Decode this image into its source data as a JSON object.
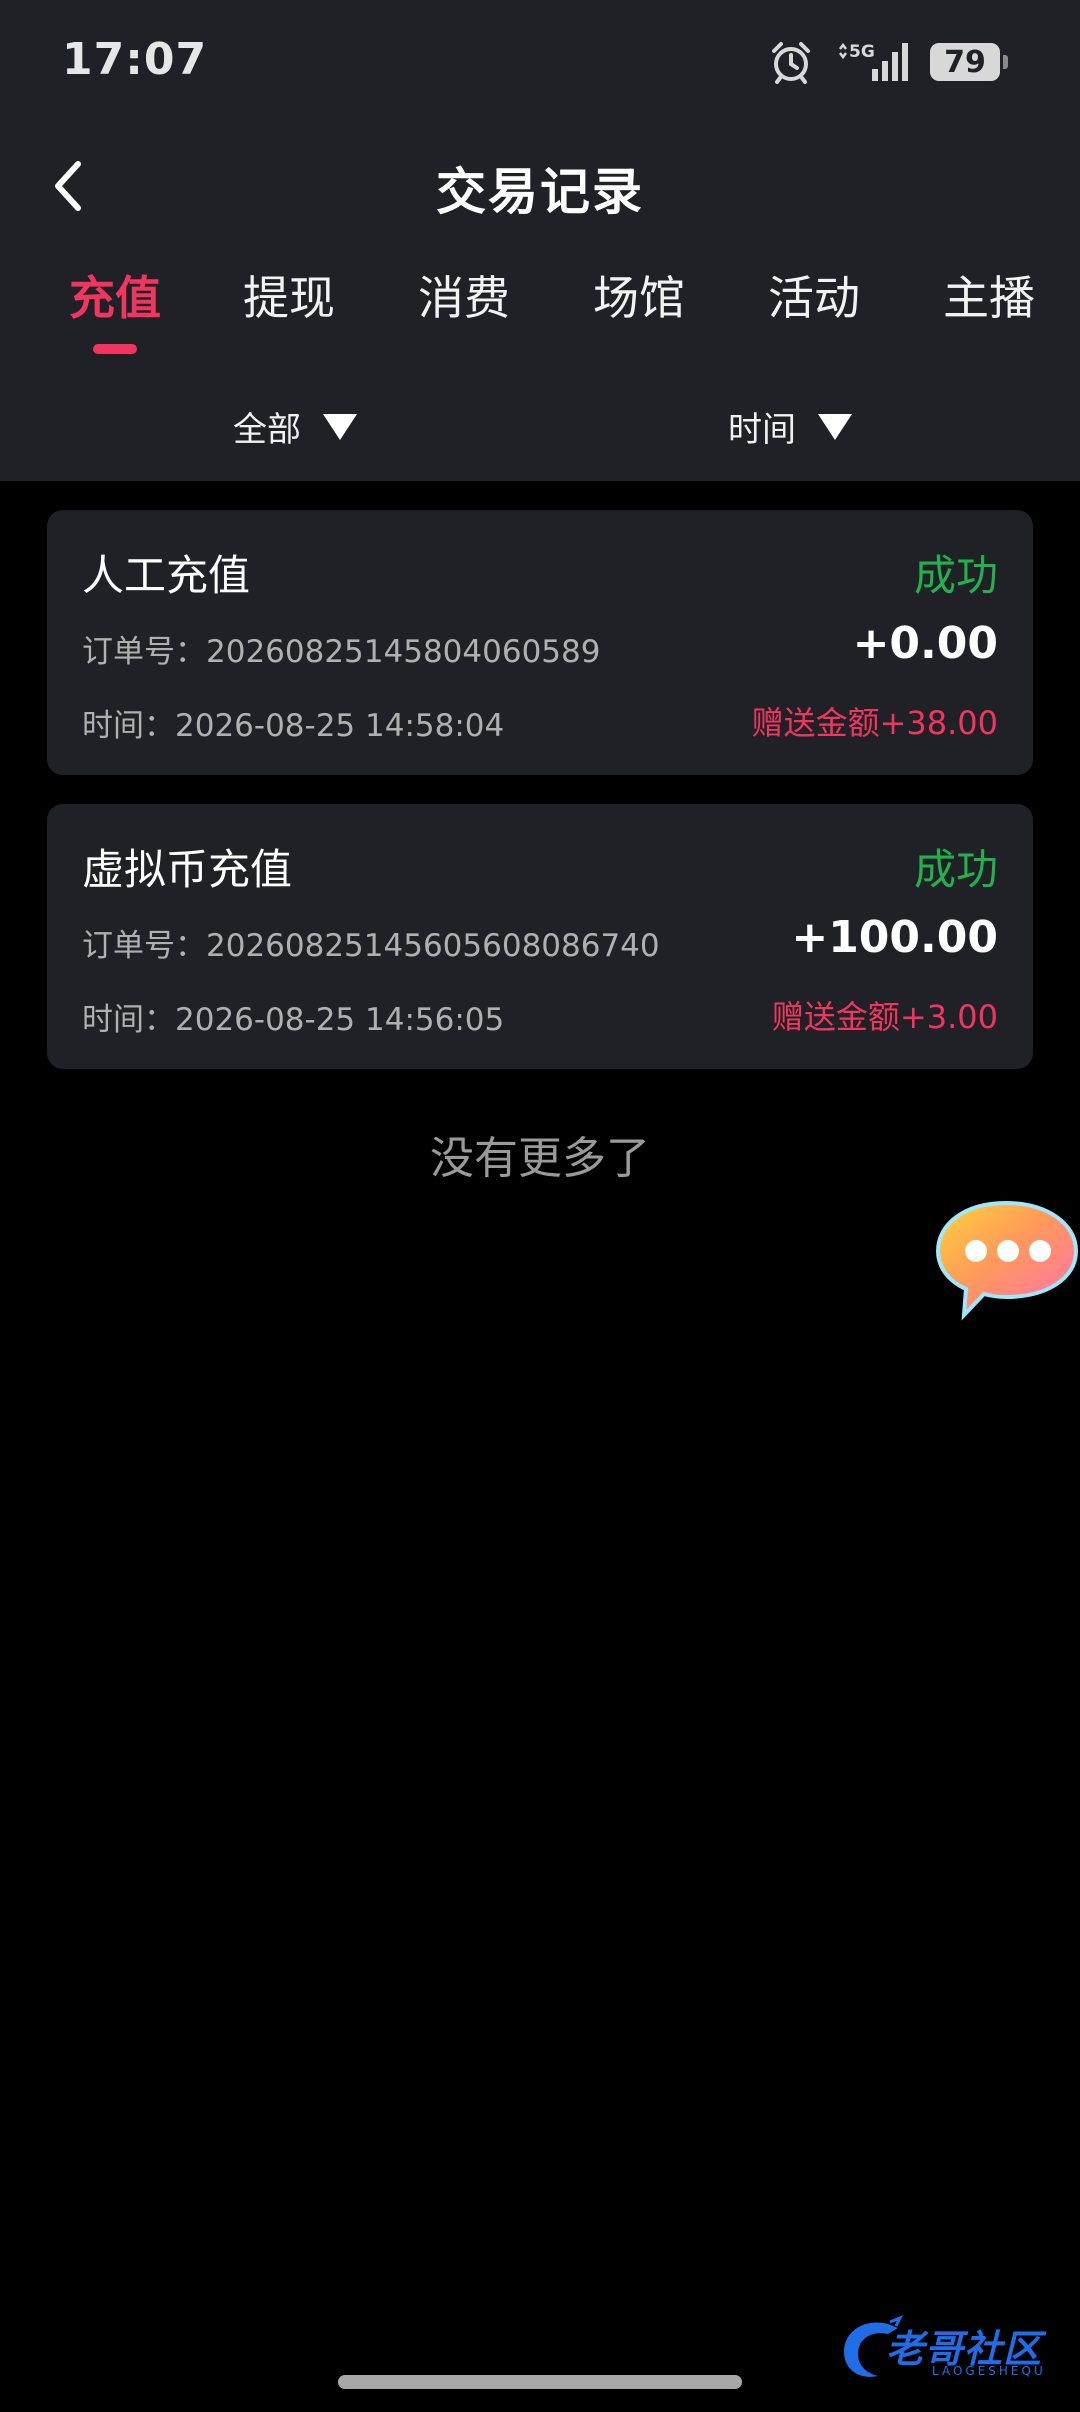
{
  "status_bar": {
    "time": "17:07",
    "network": "5G",
    "battery": "79"
  },
  "header": {
    "title": "交易记录"
  },
  "tabs": [
    {
      "label": "充值",
      "active": true
    },
    {
      "label": "提现",
      "active": false
    },
    {
      "label": "消费",
      "active": false
    },
    {
      "label": "场馆",
      "active": false
    },
    {
      "label": "活动",
      "active": false
    },
    {
      "label": "主播",
      "active": false
    }
  ],
  "filters": {
    "type": "全部",
    "time": "时间"
  },
  "records": [
    {
      "type": "人工充值",
      "status": "成功",
      "order": "订单号：20260825145804060589",
      "amount": "+0.00",
      "time": "时间：2026-08-25 14:58:04",
      "bonus": "赠送金额+38.00"
    },
    {
      "type": "虚拟币充值",
      "status": "成功",
      "order": "订单号：20260825145605608086740",
      "amount": "+100.00",
      "time": "时间：2026-08-25 14:56:05",
      "bonus": "赠送金额+3.00"
    }
  ],
  "list_end": "没有更多了",
  "watermark": {
    "logo": "老哥社区",
    "sub": "LAOGESHEQU"
  },
  "colors": {
    "accent": "#f0365e",
    "success": "#22b14c",
    "card_bg": "#1f2126",
    "page_bg": "#000000"
  }
}
